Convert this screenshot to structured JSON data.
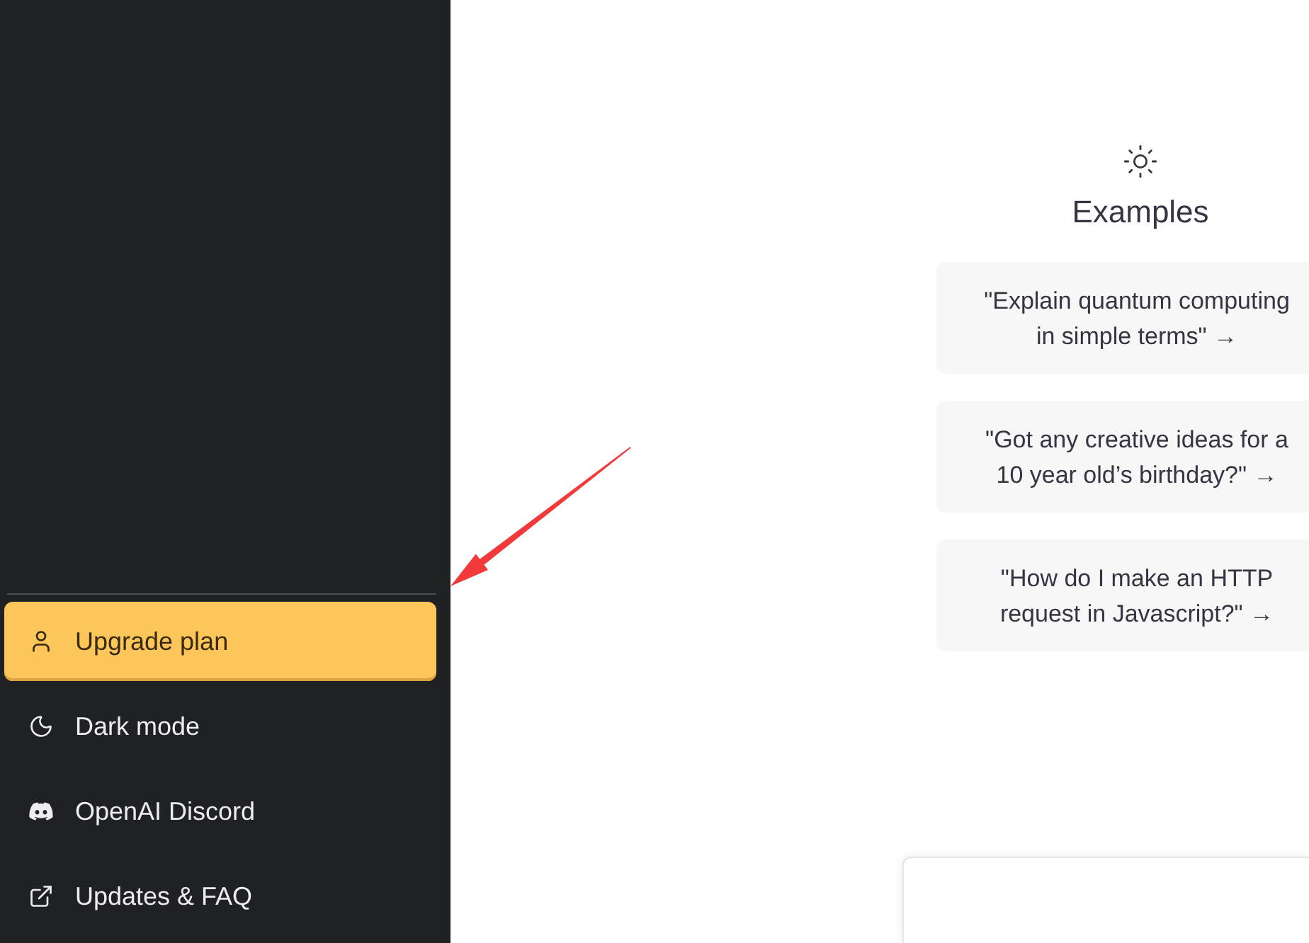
{
  "sidebar": {
    "items": [
      {
        "label": "Upgrade plan",
        "highlighted": true
      },
      {
        "label": "Dark mode",
        "highlighted": false
      },
      {
        "label": "OpenAI Discord",
        "highlighted": false
      },
      {
        "label": "Updates & FAQ",
        "highlighted": false
      }
    ]
  },
  "examples": {
    "title": "Examples",
    "prompts": [
      "\"Explain quantum computing\nin simple terms\" →",
      "\"Got any creative ideas for a\n10 year old’s birthday?\" →",
      "\"How do I make an HTTP\nrequest in Javascript?\" →"
    ]
  }
}
